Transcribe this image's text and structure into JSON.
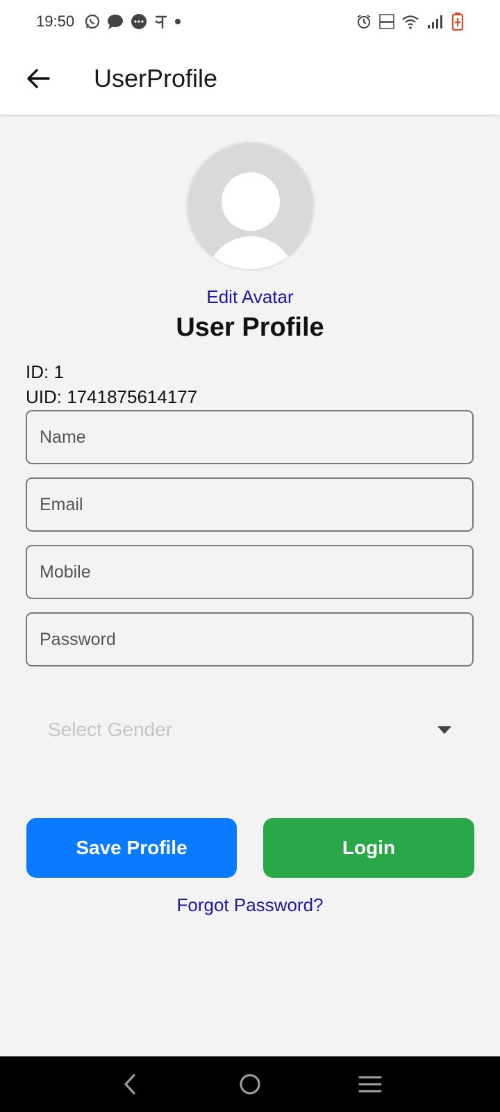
{
  "status_bar": {
    "time": "19:50",
    "notification_icons": [
      "whatsapp-icon",
      "message-icon",
      "chat-icon",
      "phonepe-icon",
      "dot-icon"
    ],
    "system_icons": [
      "alarm-icon",
      "volte-icon",
      "wifi-icon",
      "signal-icon",
      "battery-icon"
    ]
  },
  "app_bar": {
    "title": "UserProfile"
  },
  "profile": {
    "edit_avatar": "Edit Avatar",
    "section_title": "User Profile",
    "id_line": "ID: 1",
    "uid_line": "UID: 1741875614177"
  },
  "form": {
    "name_placeholder": "Name",
    "email_placeholder": "Email",
    "mobile_placeholder": "Mobile",
    "password_placeholder": "Password",
    "gender_placeholder": "Select Gender"
  },
  "actions": {
    "save_label": "Save Profile",
    "login_label": "Login",
    "forgot_label": "Forgot Password?"
  },
  "colors": {
    "save": "#0a7bff",
    "login": "#2aa748",
    "link": "#1a1aa6"
  }
}
